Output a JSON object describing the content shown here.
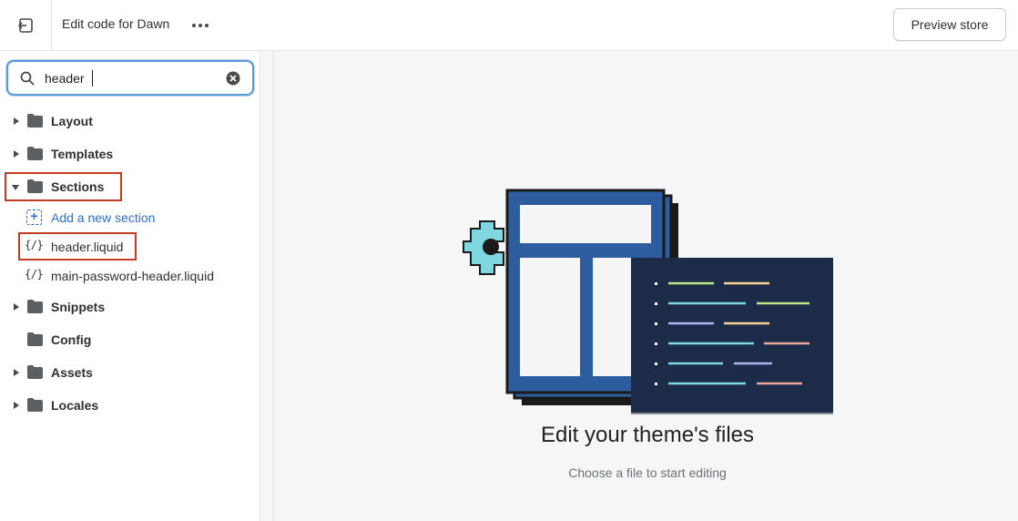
{
  "topbar": {
    "exit_icon": "exit-icon",
    "title": "Edit code for Dawn",
    "more_icon": "more-horizontal-icon",
    "preview_label": "Preview store"
  },
  "search": {
    "value": "header",
    "search_icon": "search-icon",
    "clear_icon": "clear-circle-icon"
  },
  "tree": {
    "folders": [
      {
        "label": "Layout",
        "expanded": false
      },
      {
        "label": "Templates",
        "expanded": false
      },
      {
        "label": "Sections",
        "expanded": true,
        "highlighted": true
      },
      {
        "label": "Snippets",
        "expanded": false
      },
      {
        "label": "Config",
        "expanded": false
      },
      {
        "label": "Assets",
        "expanded": false
      },
      {
        "label": "Locales",
        "expanded": false
      }
    ],
    "add_section_label": "Add a new section",
    "files": [
      {
        "label": "header.liquid",
        "highlighted": true
      },
      {
        "label": "main-password-header.liquid",
        "highlighted": false
      }
    ],
    "file_icon_text": "{/}"
  },
  "empty_state": {
    "title": "Edit your theme's files",
    "subtitle": "Choose a file to start editing"
  },
  "colors": {
    "highlight": "#c23b22",
    "link": "#2c6ecb",
    "focus_ring": "#5b9bd5",
    "illustration_blue": "#2d5d9f",
    "illustration_navy": "#1c2b48",
    "illustration_cyan": "#7fd8e0"
  }
}
